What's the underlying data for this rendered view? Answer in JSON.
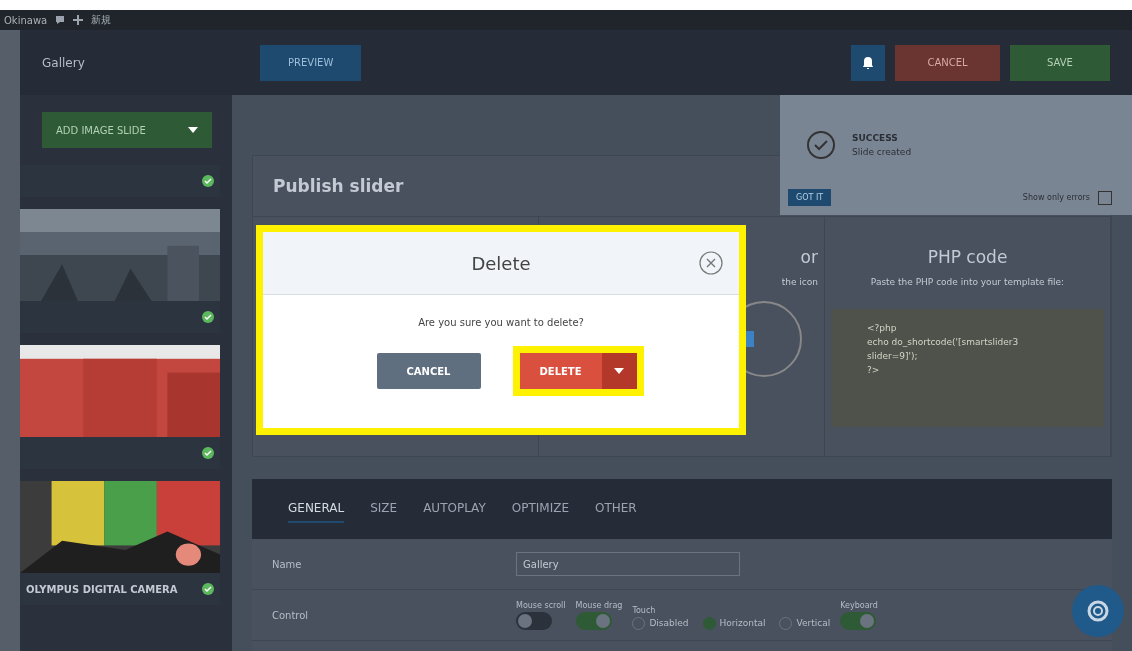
{
  "admin_bar": {
    "items": [
      "Okinawa",
      "新規"
    ]
  },
  "sidebar": {
    "title": "Gallery",
    "add_button": "ADD IMAGE SLIDE",
    "slides": [
      {
        "kind": "blank"
      },
      {
        "kind": "picture"
      },
      {
        "kind": "picture"
      },
      {
        "kind": "picture",
        "caption": "OLYMPUS DIGITAL CAMERA"
      }
    ]
  },
  "header": {
    "preview": "PREVIEW",
    "cancel": "CANCEL",
    "save": "SAVE"
  },
  "notification": {
    "title": "SUCCESS",
    "message": "Slide created",
    "button": "GOT IT",
    "filter_label": "Show only errors",
    "filter_checked": false
  },
  "publish": {
    "title": "Publish slider",
    "columns": [
      {
        "title": "or",
        "subtitle": "the icon"
      },
      {
        "title": "PHP code",
        "subtitle": "Paste the PHP code into your template file:",
        "code": [
          "<?php",
          "echo do_shortcode('[smartslider3",
          "slider=9]');",
          "?>"
        ]
      }
    ]
  },
  "tabs": [
    {
      "label": "GENERAL",
      "selected": true
    },
    {
      "label": "SIZE",
      "selected": false
    },
    {
      "label": "AUTOPLAY",
      "selected": false
    },
    {
      "label": "OPTIMIZE",
      "selected": false
    },
    {
      "label": "OTHER",
      "selected": false
    }
  ],
  "form": {
    "name_label": "Name",
    "name_value": "Gallery",
    "control_label": "Control",
    "controls": [
      {
        "kind": "toggle",
        "label": "Mouse scroll",
        "on": false
      },
      {
        "kind": "toggle",
        "label": "Mouse drag",
        "on": true
      },
      {
        "kind": "radio",
        "label": "Touch",
        "options": [
          {
            "label": "Disabled",
            "selected": false
          },
          {
            "label": "Horizontal",
            "selected": true
          },
          {
            "label": "Vertical",
            "selected": false
          }
        ]
      },
      {
        "kind": "toggle",
        "label": "Keyboard",
        "on": true
      }
    ]
  },
  "dialog": {
    "title": "Delete",
    "message": "Are you sure you want to delete?",
    "cancel": "CANCEL",
    "confirm": "DELETE"
  }
}
